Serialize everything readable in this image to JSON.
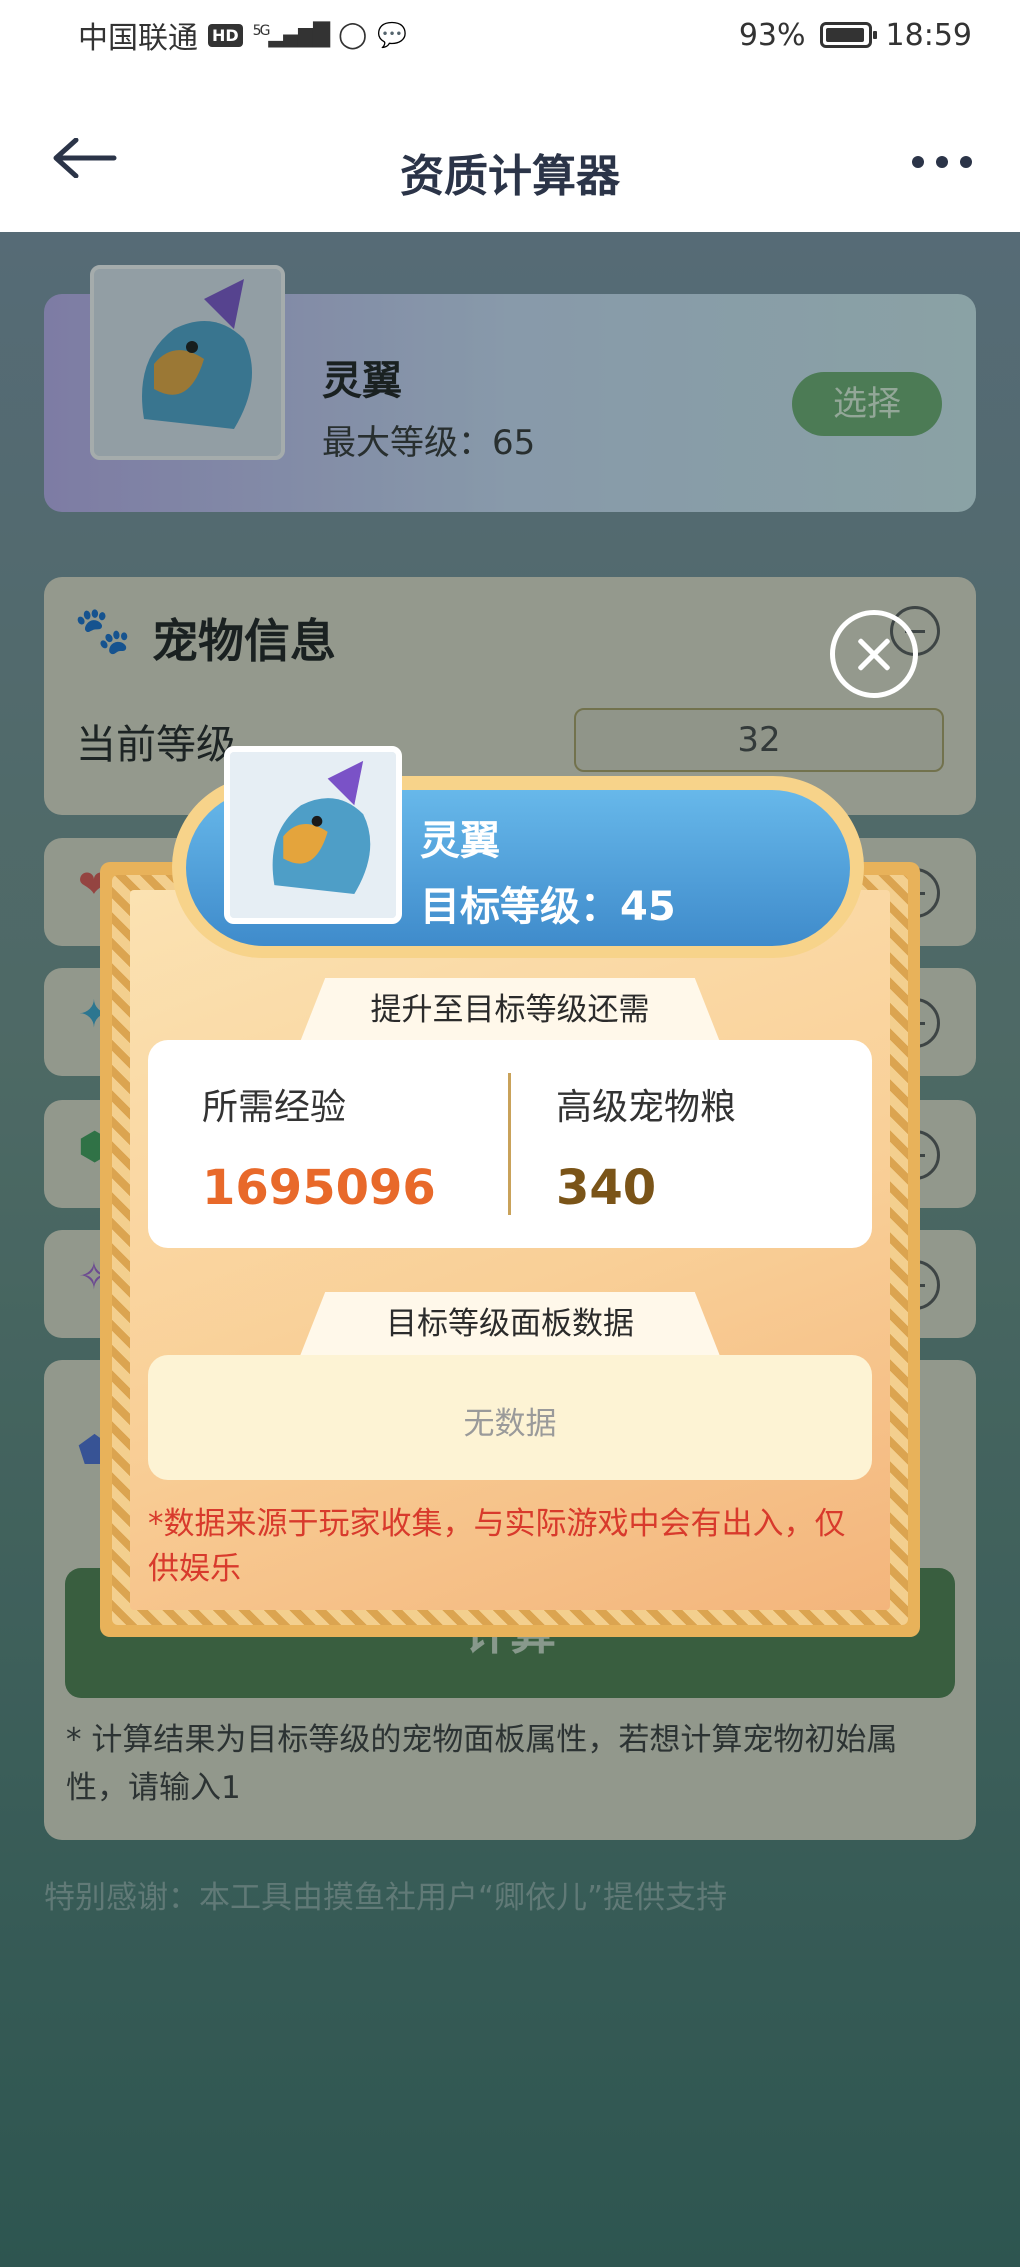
{
  "status_bar": {
    "carrier": "中国联通",
    "hd": "HD",
    "signal": "5G",
    "battery": "93%",
    "time": "18:59"
  },
  "header": {
    "title": "资质计算器"
  },
  "pet_card": {
    "name": "灵翼",
    "max_level": "最大等级：65",
    "select_button": "选择"
  },
  "info_card": {
    "title": "宠物信息",
    "current_level_label": "当前等级",
    "current_level_value": "32"
  },
  "calculate_button": "计算",
  "note": "* 计算结果为目标等级的宠物面板属性，若想计算宠物初始属性，请输入1",
  "thanks": "特别感谢：本工具由摸鱼社用户“卿依儿”提供支持",
  "modal": {
    "pet_name": "灵翼",
    "target_level": "目标等级：45",
    "section1_title": "提升至目标等级还需",
    "exp_label": "所需经验",
    "exp_value": "1695096",
    "food_label": "高级宠物粮",
    "food_value": "340",
    "section2_title": "目标等级面板数据",
    "no_data": "无数据",
    "warning": "*数据来源于玩家收集，与实际游戏中会有出入，仅供娱乐"
  },
  "colors": {
    "exp_value": "#e8692a",
    "food_value": "#7a5418",
    "warning": "#d83a2c",
    "banner": "#4a98d4"
  }
}
